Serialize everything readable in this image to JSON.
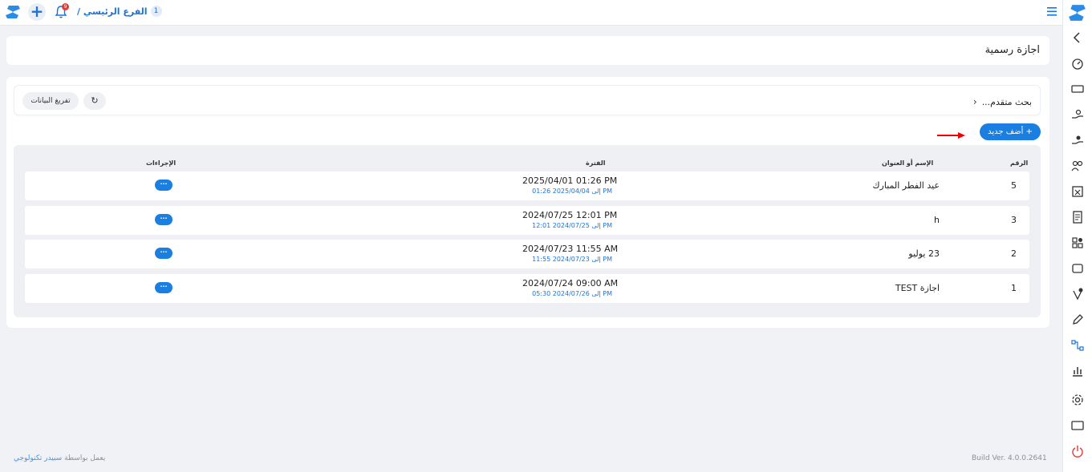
{
  "topbar": {
    "branch_label": "الفرع الرئيسي /",
    "branch_count": "1",
    "notification_count": "9"
  },
  "page": {
    "title": "اجازة رسمية"
  },
  "search": {
    "advanced_label": "بحث متقدم...",
    "clear_label": "تفريغ البيانات",
    "refresh_icon": "↻"
  },
  "actions": {
    "add_new_label": "+ أضف جديد"
  },
  "table": {
    "headers": {
      "number": "الرقم",
      "name": "الإسم أو العنوان",
      "period": "الفترة",
      "actions": "الإجراءات"
    },
    "rows": [
      {
        "number": "5",
        "name": "عيد الفطر المبارك",
        "from": "2025/04/01 01:26 PM",
        "to": "إلى 2025/04/04 01:26 PM",
        "action": "···"
      },
      {
        "number": "3",
        "name": "h",
        "from": "2024/07/25 12:01 PM",
        "to": "إلى 2024/07/25 12:01 PM",
        "action": "···"
      },
      {
        "number": "2",
        "name": "23 يوليو",
        "from": "2024/07/23 11:55 AM",
        "to": "إلى 2024/07/23 11:55 PM",
        "action": "···"
      },
      {
        "number": "1",
        "name": "اجازة TEST",
        "from": "2024/07/24 09:00 AM",
        "to": "إلى 2024/07/26 05:30 PM",
        "action": "···"
      }
    ]
  },
  "footer": {
    "build": "Build Ver. 4.0.0.2641",
    "powered_by": "يعمل بواسطة",
    "company": "سبيدر تكنولوجي"
  },
  "colors": {
    "accent": "#1a7fe0",
    "danger": "#e53935"
  }
}
